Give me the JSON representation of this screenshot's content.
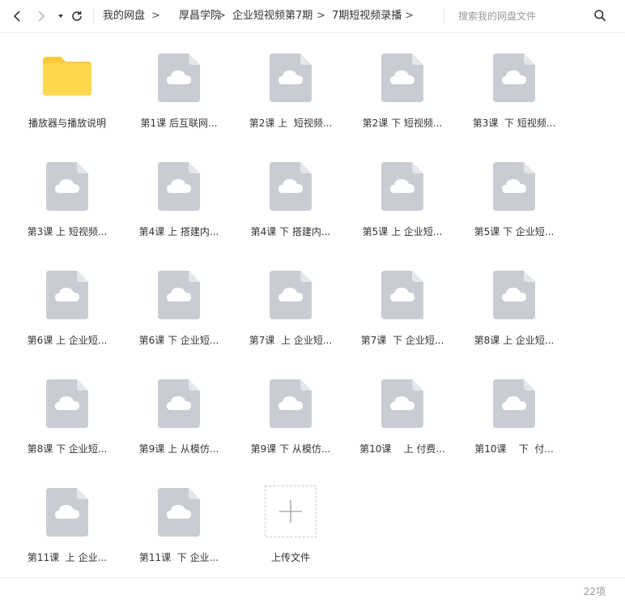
{
  "toolbar": {
    "back_icon": "chevron-left-icon",
    "forward_icon": "chevron-right-icon",
    "history_icon": "caret-down-icon",
    "refresh_icon": "refresh-icon"
  },
  "breadcrumb": {
    "items": [
      "我的网盘",
      "厚昌学院",
      "企业短视频第7期",
      "7期短视频录播"
    ],
    "separator": ">"
  },
  "search": {
    "placeholder": "搜索我的网盘文件",
    "icon": "search-icon"
  },
  "files": [
    {
      "name": "播放器与播放说明",
      "type": "folder"
    },
    {
      "name": "第1课 后互联网...",
      "type": "file"
    },
    {
      "name": "第2课 上  短视频...",
      "type": "file"
    },
    {
      "name": "第2课 下 短视频...",
      "type": "file"
    },
    {
      "name": "第3课  下 短视频...",
      "type": "file"
    },
    {
      "name": "第3课 上 短视频...",
      "type": "file"
    },
    {
      "name": "第4课 上 搭建内...",
      "type": "file"
    },
    {
      "name": "第4课 下 搭建内...",
      "type": "file"
    },
    {
      "name": "第5课 上 企业短...",
      "type": "file"
    },
    {
      "name": "第5课 下 企业短...",
      "type": "file"
    },
    {
      "name": "第6课 上 企业短...",
      "type": "file"
    },
    {
      "name": "第6课 下 企业短...",
      "type": "file"
    },
    {
      "name": "第7课  上 企业短...",
      "type": "file"
    },
    {
      "name": "第7课  下 企业短...",
      "type": "file"
    },
    {
      "name": "第8课 上 企业短...",
      "type": "file"
    },
    {
      "name": "第8课 下 企业短...",
      "type": "file"
    },
    {
      "name": "第9课 上 从模仿...",
      "type": "file"
    },
    {
      "name": "第9课 下 从模仿...",
      "type": "file"
    },
    {
      "name": "第10课    上 付费...",
      "type": "file"
    },
    {
      "name": "第10课    下  付...",
      "type": "file"
    },
    {
      "name": "第11课  上 企业...",
      "type": "file"
    },
    {
      "name": "第11课  下 企业...",
      "type": "file"
    }
  ],
  "upload": {
    "label": "上传文件",
    "icon": "plus-icon"
  },
  "footer": {
    "count": "22项"
  },
  "colors": {
    "folder": "#FFD84D",
    "folder_tab": "#F8C93B",
    "file_icon": "#C9CCD2",
    "cloud": "#FFFFFF",
    "border": "#EEEEEE"
  }
}
